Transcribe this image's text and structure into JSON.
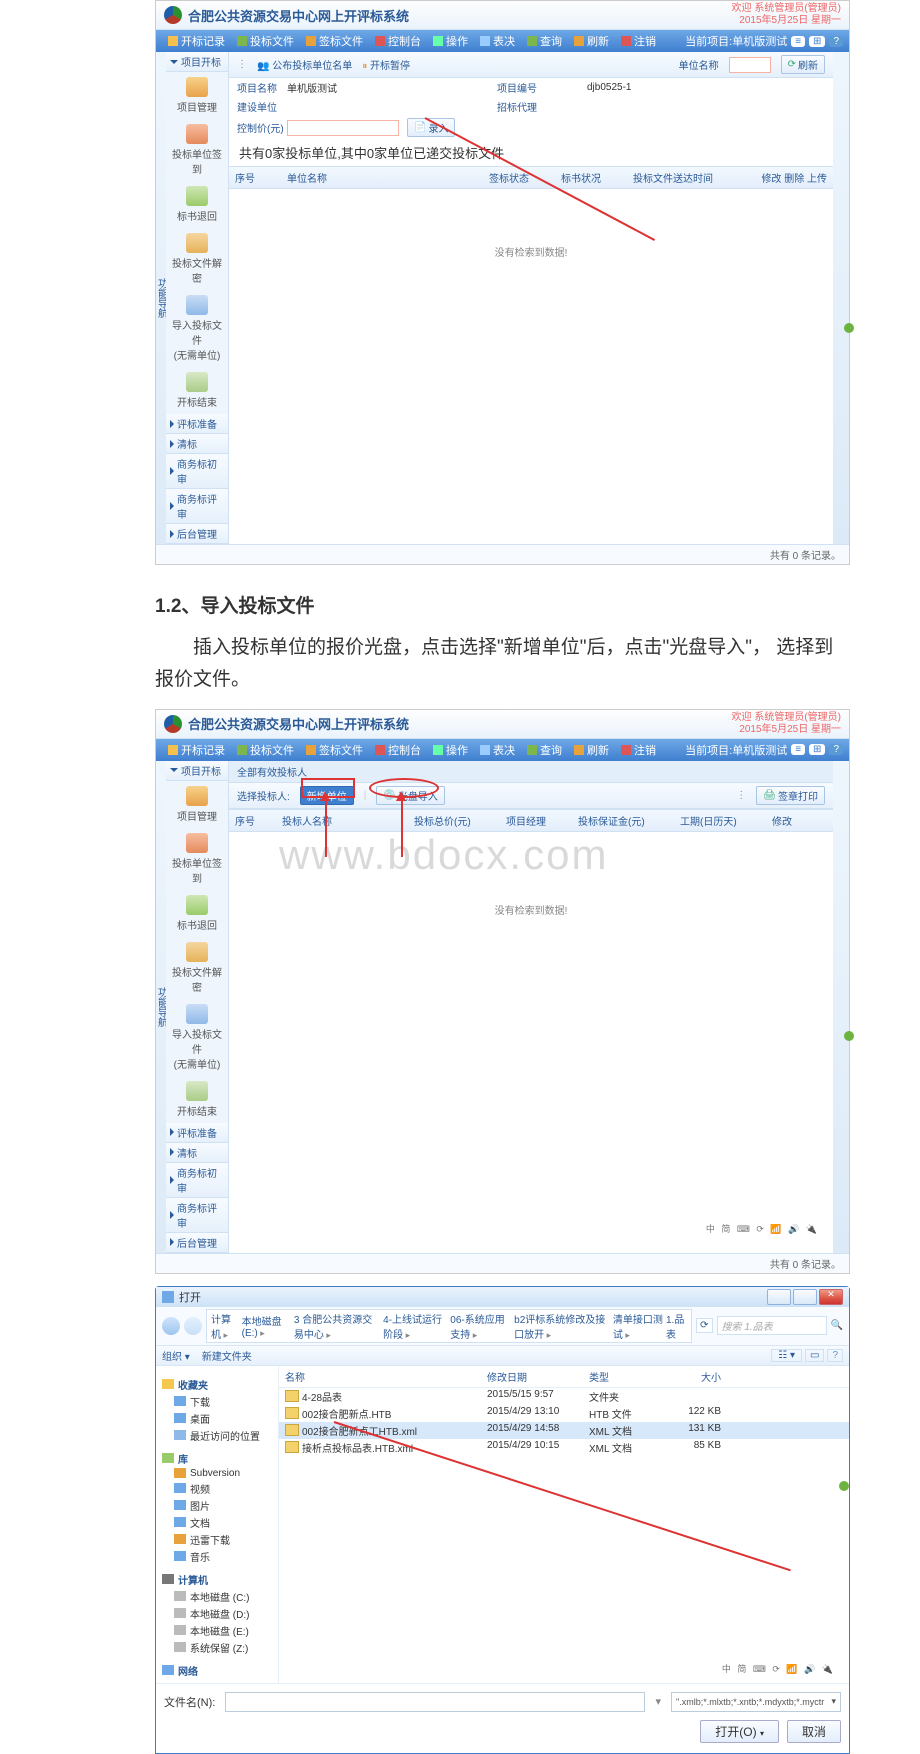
{
  "doc": {
    "section_number": "1.2",
    "section_title": "导入投标文件",
    "paragraph": "插入投标单位的报价光盘，点击选择\"新增单位\"后，点击\"光盘导入\"， 选择到报价文件。"
  },
  "app": {
    "title": "合肥公共资源交易中心网上开评标系统",
    "welcome_line1": "欢迎 系统管理员(管理员)",
    "welcome_line2": "2015年5月25日 星期一",
    "current_project_label": "当前项目:",
    "current_project": "单机版测试",
    "menus": {
      "log": "开标记录",
      "bid_docs": "投标文件",
      "sign_docs": "签标文件",
      "control": "控制台",
      "operate": "操作",
      "chat": "表决",
      "query": "查询",
      "refresh": "刷新",
      "logout": "注销"
    },
    "gutter_label": "功能导航"
  },
  "sidebar": {
    "open_bid": "项目开标",
    "items": {
      "proj_mgmt": "项目管理",
      "unit_signin": "投标单位签到",
      "doc_return": "标书退回",
      "doc_decrypt": "投标文件解密",
      "import_no_unit_l1": "导入投标文件",
      "import_no_unit_l2": "(无需单位)",
      "open_result": "开标结束"
    },
    "sections": {
      "review_prep": "评标准备",
      "clear": "清标",
      "biz_pre": "商务标初审",
      "biz_review": "商务标评审",
      "backend": "后台管理"
    }
  },
  "screen1": {
    "toolbar": {
      "list": "公布投标单位名单",
      "pause": "开标暂停"
    },
    "form": {
      "proj_name_label": "项目名称",
      "proj_name_value": "单机版测试",
      "proj_no_label": "项目编号",
      "proj_no_value": "djb0525-1",
      "build_unit_label": "建设单位",
      "agent_label": "招标代理",
      "ctrl_price_label": "控制价(元)",
      "import_btn": "录入",
      "unit_name_label": "单位名称"
    },
    "big_msg": "共有0家投标单位,其中0家单位已递交投标文件",
    "table": {
      "seq": "序号",
      "unit_name": "单位名称",
      "sign_status": "签标状态",
      "doc_status": "标书状况",
      "send_time": "投标文件送达时间",
      "ops": "修改 删除 上传"
    },
    "empty": "没有检索到数据!",
    "refresh_btn": "刷新",
    "foot": "共有 0 条记录。"
  },
  "screen2": {
    "toolbar": {
      "select_label": "选择投标人:",
      "all_valid": "全部有效投标人",
      "new_unit": "新增单位",
      "import_cd": "光盘导入",
      "print": "签章打印"
    },
    "table": {
      "seq": "序号",
      "bidder": "投标人名称",
      "total_price": "投标总价(元)",
      "pm": "项目经理",
      "deposit": "投标保证金(元)",
      "duration": "工期(日历天)",
      "edit": "修改"
    },
    "empty": "没有检索到数据!",
    "foot": "共有 0 条记录。",
    "tray": "中 简 ⌨ ⟳ 📶 🔊 🔌"
  },
  "dialog": {
    "title": "打开",
    "breadcrumb": [
      "计算机",
      "本地磁盘 (E:)",
      "3 合肥公共资源交易中心",
      "4-上线试运行阶段",
      "06-系统应用支持",
      "b2评标系统修改及接口放开",
      "清单接口测试",
      "1.品表"
    ],
    "nav": {
      "org": "组织 ▾",
      "new_folder": "新建文件夹"
    },
    "tree": {
      "fav": "收藏夹",
      "downloads": "下载",
      "desktop": "桌面",
      "recent": "最近访问的位置",
      "lib": "库",
      "svn": "Subversion",
      "video": "视频",
      "pic": "图片",
      "doc": "文档",
      "thunder": "迅雷下载",
      "music": "音乐",
      "computer": "计算机",
      "c": "本地磁盘 (C:)",
      "d": "本地磁盘 (D:)",
      "e": "本地磁盘 (E:)",
      "z": "系统保留 (Z:)",
      "network": "网络"
    },
    "columns": {
      "name": "名称",
      "date": "修改日期",
      "type": "类型",
      "size": "大小"
    },
    "files": [
      {
        "name": "4-28品表",
        "date": "2015/5/15 9:57",
        "type": "文件夹",
        "size": ""
      },
      {
        "name": "002接合肥新点.HTB",
        "date": "2015/4/29 13:10",
        "type": "HTB 文件",
        "size": "122 KB"
      },
      {
        "name": "002接合肥新点工HTB.xml",
        "date": "2015/4/29 14:58",
        "type": "XML 文档",
        "size": "131 KB"
      },
      {
        "name": "接析点投标品表.HTB.xml",
        "date": "2015/4/29 10:15",
        "type": "XML 文档",
        "size": "85 KB"
      }
    ],
    "search_placeholder": "搜索 1.品表",
    "filename_label": "文件名(N):",
    "type_filter": "\".xmlb;*.mlxtb;*.xntb;*.mdyxtb;*.myctr",
    "open_btn": "打开(O)",
    "cancel_btn": "取消",
    "tray": "中 简 ⌨ ⟳ 📶 🔊 🔌"
  },
  "watermark": "www.bdocx.com"
}
